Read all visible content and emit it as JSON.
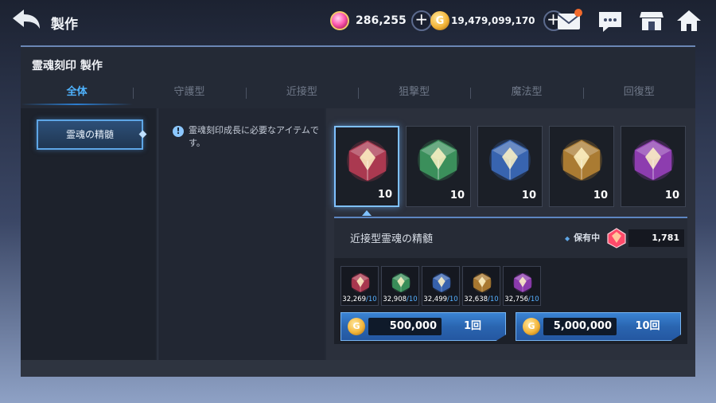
{
  "header": {
    "title": "製作",
    "gems": "286,255",
    "gold": "19,479,099,170",
    "gold_symbol": "G",
    "icons": [
      "back-arrow-icon",
      "gem-icon",
      "plus-icon",
      "gold-coin-icon",
      "mail-icon",
      "chat-icon",
      "shop-icon",
      "home-icon"
    ],
    "mail_badge_color": "#f26a2c"
  },
  "panel": {
    "title": "霊魂刻印 製作",
    "tabs": [
      "全体",
      "守護型",
      "近接型",
      "狙撃型",
      "魔法型",
      "回復型"
    ],
    "active_tab": "全体"
  },
  "category": {
    "label": "霊魂の精髄"
  },
  "description": "霊魂刻印成長に必要なアイテムです。",
  "items": [
    {
      "color": "#ff4a6a",
      "count": "10",
      "selected": true
    },
    {
      "color": "#4fd27a",
      "count": "10",
      "selected": false
    },
    {
      "color": "#4a8dff",
      "count": "10",
      "selected": false
    },
    {
      "color": "#ffb23a",
      "count": "10",
      "selected": false
    },
    {
      "color": "#d050ff",
      "count": "10",
      "selected": false
    }
  ],
  "detail": {
    "name": "近接型霊魂の精髄",
    "held_label": "保有中",
    "held_count": "1,781",
    "materials": [
      {
        "color": "#ff4a6a",
        "have": "32,269",
        "need": "/10"
      },
      {
        "color": "#4fd27a",
        "have": "32,908",
        "need": "/10"
      },
      {
        "color": "#4a8dff",
        "have": "32,499",
        "need": "/10"
      },
      {
        "color": "#ffb23a",
        "have": "32,638",
        "need": "/10"
      },
      {
        "color": "#d050ff",
        "have": "32,756",
        "need": "/10"
      }
    ],
    "buy_buttons": [
      {
        "price": "500,000",
        "label": "1回"
      },
      {
        "price": "5,000,000",
        "label": "10回"
      }
    ]
  }
}
